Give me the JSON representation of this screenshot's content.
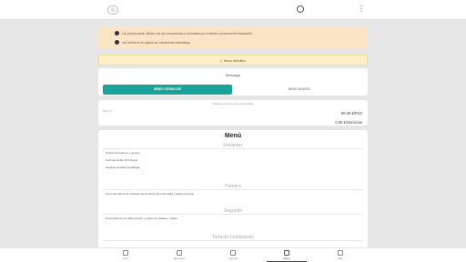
{
  "header": {
    "logo_text": "",
    "logo_glyph": "◎"
  },
  "alerts": [
    "Los precios serán válidos una vez comprobada y confirmada por el cliente o personal del restaurante.",
    "Las fechas de los platos son meramente orientativas."
  ],
  "menu_definitivo": "✓ Menú definitivo",
  "download": {
    "title": "Descargar",
    "primary_label": "MENÚ / DESGLOSE",
    "secondary_label": "MENÚ INFANTIL"
  },
  "pricing": {
    "note": "Todos los precios tienen IVA incluido",
    "pax_label": "PAX x 1",
    "pax_value": "90,00 €/PAX",
    "services_value": "0,00 €/Servicios"
  },
  "menu": {
    "title": "Menú",
    "sections": [
      {
        "name": "Entrantes",
        "items": [
          "Surtido de ibéricos y quesos",
          "Anchoas doble 00 Arbeyal",
          "Gambas cocidas de Málaga"
        ]
      },
      {
        "name": "Primero",
        "items": [
          "Lomo de lubina con bouquet de verduras de temporada y salsa cremosa"
        ]
      },
      {
        "name": "Segundo",
        "items": [
          "Presa ibérica con salsa Oporto y gratén de patatas y pasas"
        ]
      },
      {
        "name": "Tarta de Celebración",
        "items": []
      }
    ]
  },
  "bottom_nav": [
    {
      "label": "Inicio",
      "icon": "home-icon"
    },
    {
      "label": "Mensajes",
      "icon": "message-icon"
    },
    {
      "label": "Agenda",
      "icon": "calendar-icon"
    },
    {
      "label": "Menú",
      "icon": "menu-icon"
    },
    {
      "label": "Más",
      "icon": "more-icon"
    }
  ]
}
